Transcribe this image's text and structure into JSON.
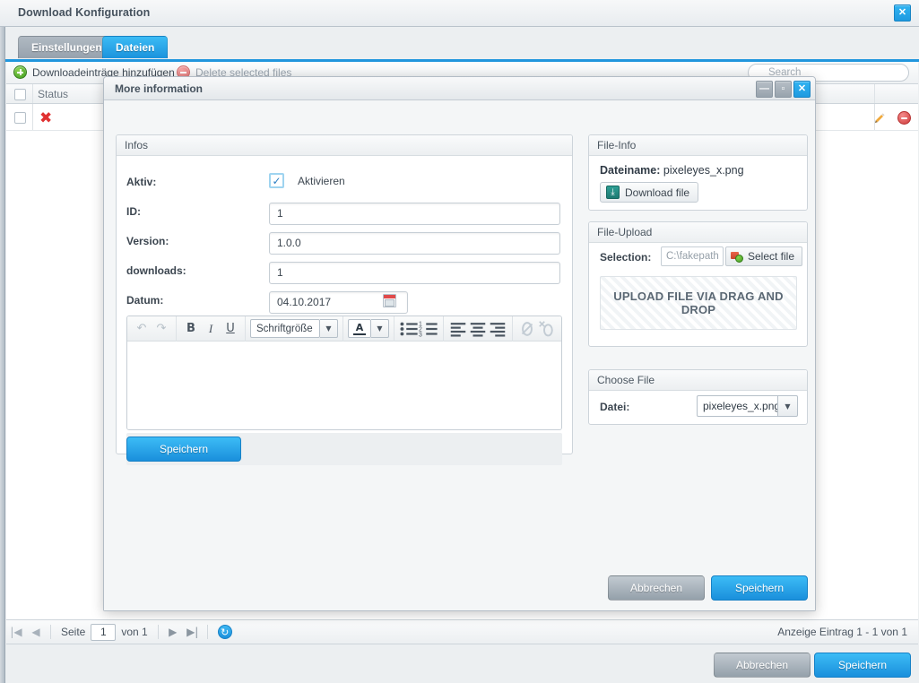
{
  "window": {
    "title": "Download Konfiguration",
    "close_label": "✕"
  },
  "tabs": [
    {
      "label": "Einstellungen",
      "active": false
    },
    {
      "label": "Dateien",
      "active": true
    }
  ],
  "grid_toolbar": {
    "add_label": "Downloadeinträge hinzufügen",
    "delete_label": "Delete selected files",
    "search_placeholder": "Search"
  },
  "grid": {
    "columns": [
      "Status"
    ],
    "row_status_icon": "✖"
  },
  "pager": {
    "first": "|◀",
    "prev": "◀",
    "page_label": "Seite",
    "page_value": "1",
    "of_label": "von 1",
    "next": "▶",
    "last": "▶|",
    "refresh": "↻",
    "info": "Anzeige Eintrag 1 - 1 von 1"
  },
  "outer_footer": {
    "cancel_label": "Abbrechen",
    "save_label": "Speichern"
  },
  "modal": {
    "title": "More information",
    "minimize_label": "—",
    "maximize_label": "▫",
    "close_label": "✕",
    "cancel_label": "Abbrechen",
    "save_label": "Speichern",
    "infos": {
      "panel_title": "Infos",
      "aktiv_label": "Aktiv:",
      "aktivieren_label": "Aktivieren",
      "aktiv_checked": "✓",
      "id_label": "ID:",
      "id_value": "1",
      "version_label": "Version:",
      "version_value": "1.0.0",
      "downloads_label": "downloads:",
      "downloads_value": "1",
      "datum_label": "Datum:",
      "datum_value": "04.10.2017",
      "save_label": "Speichern"
    },
    "editor": {
      "undo": "↶",
      "redo": "↷",
      "bold": "B",
      "italic": "I",
      "underline": "U",
      "fontsize_value": "Schriftgröße",
      "caret": "▼",
      "color_letter": "A",
      "bullet_list": "☰",
      "number_list": "≡",
      "align_left": "▤",
      "align_center": "▤",
      "align_right": "▤",
      "link": "🔗",
      "unlink": "⛓",
      "content": ""
    },
    "file_info": {
      "panel_title": "File-Info",
      "filename_label": "Dateiname:",
      "filename_value": "pixeleyes_x.png",
      "download_label": "Download file",
      "download_glyph": "⤓"
    },
    "file_upload": {
      "panel_title": "File-Upload",
      "selection_label": "Selection:",
      "path_value": "C:\\fakepath",
      "select_file_label": "Select file",
      "dropzone_label": "UPLOAD FILE VIA DRAG AND DROP"
    },
    "choose_file": {
      "panel_title": "Choose File",
      "datei_label": "Datei:",
      "datei_value": "pixeleyes_x.png",
      "caret": "▼"
    }
  },
  "colors": {
    "accent_blue": "#1f97de",
    "tab_gray": "#97a2ad",
    "panel_border": "#cdd4da",
    "danger_red": "#e03131",
    "success_green": "#3f9c22"
  }
}
